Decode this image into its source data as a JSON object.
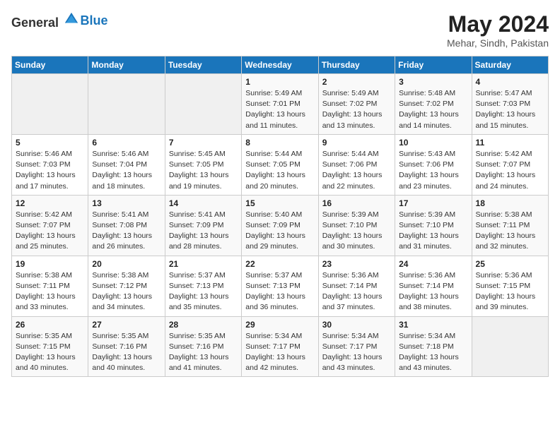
{
  "header": {
    "logo_general": "General",
    "logo_blue": "Blue",
    "month": "May 2024",
    "location": "Mehar, Sindh, Pakistan"
  },
  "weekdays": [
    "Sunday",
    "Monday",
    "Tuesday",
    "Wednesday",
    "Thursday",
    "Friday",
    "Saturday"
  ],
  "weeks": [
    [
      {
        "day": "",
        "sunrise": "",
        "sunset": "",
        "daylight": ""
      },
      {
        "day": "",
        "sunrise": "",
        "sunset": "",
        "daylight": ""
      },
      {
        "day": "",
        "sunrise": "",
        "sunset": "",
        "daylight": ""
      },
      {
        "day": "1",
        "sunrise": "Sunrise: 5:49 AM",
        "sunset": "Sunset: 7:01 PM",
        "daylight": "Daylight: 13 hours and 11 minutes."
      },
      {
        "day": "2",
        "sunrise": "Sunrise: 5:49 AM",
        "sunset": "Sunset: 7:02 PM",
        "daylight": "Daylight: 13 hours and 13 minutes."
      },
      {
        "day": "3",
        "sunrise": "Sunrise: 5:48 AM",
        "sunset": "Sunset: 7:02 PM",
        "daylight": "Daylight: 13 hours and 14 minutes."
      },
      {
        "day": "4",
        "sunrise": "Sunrise: 5:47 AM",
        "sunset": "Sunset: 7:03 PM",
        "daylight": "Daylight: 13 hours and 15 minutes."
      }
    ],
    [
      {
        "day": "5",
        "sunrise": "Sunrise: 5:46 AM",
        "sunset": "Sunset: 7:03 PM",
        "daylight": "Daylight: 13 hours and 17 minutes."
      },
      {
        "day": "6",
        "sunrise": "Sunrise: 5:46 AM",
        "sunset": "Sunset: 7:04 PM",
        "daylight": "Daylight: 13 hours and 18 minutes."
      },
      {
        "day": "7",
        "sunrise": "Sunrise: 5:45 AM",
        "sunset": "Sunset: 7:05 PM",
        "daylight": "Daylight: 13 hours and 19 minutes."
      },
      {
        "day": "8",
        "sunrise": "Sunrise: 5:44 AM",
        "sunset": "Sunset: 7:05 PM",
        "daylight": "Daylight: 13 hours and 20 minutes."
      },
      {
        "day": "9",
        "sunrise": "Sunrise: 5:44 AM",
        "sunset": "Sunset: 7:06 PM",
        "daylight": "Daylight: 13 hours and 22 minutes."
      },
      {
        "day": "10",
        "sunrise": "Sunrise: 5:43 AM",
        "sunset": "Sunset: 7:06 PM",
        "daylight": "Daylight: 13 hours and 23 minutes."
      },
      {
        "day": "11",
        "sunrise": "Sunrise: 5:42 AM",
        "sunset": "Sunset: 7:07 PM",
        "daylight": "Daylight: 13 hours and 24 minutes."
      }
    ],
    [
      {
        "day": "12",
        "sunrise": "Sunrise: 5:42 AM",
        "sunset": "Sunset: 7:07 PM",
        "daylight": "Daylight: 13 hours and 25 minutes."
      },
      {
        "day": "13",
        "sunrise": "Sunrise: 5:41 AM",
        "sunset": "Sunset: 7:08 PM",
        "daylight": "Daylight: 13 hours and 26 minutes."
      },
      {
        "day": "14",
        "sunrise": "Sunrise: 5:41 AM",
        "sunset": "Sunset: 7:09 PM",
        "daylight": "Daylight: 13 hours and 28 minutes."
      },
      {
        "day": "15",
        "sunrise": "Sunrise: 5:40 AM",
        "sunset": "Sunset: 7:09 PM",
        "daylight": "Daylight: 13 hours and 29 minutes."
      },
      {
        "day": "16",
        "sunrise": "Sunrise: 5:39 AM",
        "sunset": "Sunset: 7:10 PM",
        "daylight": "Daylight: 13 hours and 30 minutes."
      },
      {
        "day": "17",
        "sunrise": "Sunrise: 5:39 AM",
        "sunset": "Sunset: 7:10 PM",
        "daylight": "Daylight: 13 hours and 31 minutes."
      },
      {
        "day": "18",
        "sunrise": "Sunrise: 5:38 AM",
        "sunset": "Sunset: 7:11 PM",
        "daylight": "Daylight: 13 hours and 32 minutes."
      }
    ],
    [
      {
        "day": "19",
        "sunrise": "Sunrise: 5:38 AM",
        "sunset": "Sunset: 7:11 PM",
        "daylight": "Daylight: 13 hours and 33 minutes."
      },
      {
        "day": "20",
        "sunrise": "Sunrise: 5:38 AM",
        "sunset": "Sunset: 7:12 PM",
        "daylight": "Daylight: 13 hours and 34 minutes."
      },
      {
        "day": "21",
        "sunrise": "Sunrise: 5:37 AM",
        "sunset": "Sunset: 7:13 PM",
        "daylight": "Daylight: 13 hours and 35 minutes."
      },
      {
        "day": "22",
        "sunrise": "Sunrise: 5:37 AM",
        "sunset": "Sunset: 7:13 PM",
        "daylight": "Daylight: 13 hours and 36 minutes."
      },
      {
        "day": "23",
        "sunrise": "Sunrise: 5:36 AM",
        "sunset": "Sunset: 7:14 PM",
        "daylight": "Daylight: 13 hours and 37 minutes."
      },
      {
        "day": "24",
        "sunrise": "Sunrise: 5:36 AM",
        "sunset": "Sunset: 7:14 PM",
        "daylight": "Daylight: 13 hours and 38 minutes."
      },
      {
        "day": "25",
        "sunrise": "Sunrise: 5:36 AM",
        "sunset": "Sunset: 7:15 PM",
        "daylight": "Daylight: 13 hours and 39 minutes."
      }
    ],
    [
      {
        "day": "26",
        "sunrise": "Sunrise: 5:35 AM",
        "sunset": "Sunset: 7:15 PM",
        "daylight": "Daylight: 13 hours and 40 minutes."
      },
      {
        "day": "27",
        "sunrise": "Sunrise: 5:35 AM",
        "sunset": "Sunset: 7:16 PM",
        "daylight": "Daylight: 13 hours and 40 minutes."
      },
      {
        "day": "28",
        "sunrise": "Sunrise: 5:35 AM",
        "sunset": "Sunset: 7:16 PM",
        "daylight": "Daylight: 13 hours and 41 minutes."
      },
      {
        "day": "29",
        "sunrise": "Sunrise: 5:34 AM",
        "sunset": "Sunset: 7:17 PM",
        "daylight": "Daylight: 13 hours and 42 minutes."
      },
      {
        "day": "30",
        "sunrise": "Sunrise: 5:34 AM",
        "sunset": "Sunset: 7:17 PM",
        "daylight": "Daylight: 13 hours and 43 minutes."
      },
      {
        "day": "31",
        "sunrise": "Sunrise: 5:34 AM",
        "sunset": "Sunset: 7:18 PM",
        "daylight": "Daylight: 13 hours and 43 minutes."
      },
      {
        "day": "",
        "sunrise": "",
        "sunset": "",
        "daylight": ""
      }
    ]
  ]
}
